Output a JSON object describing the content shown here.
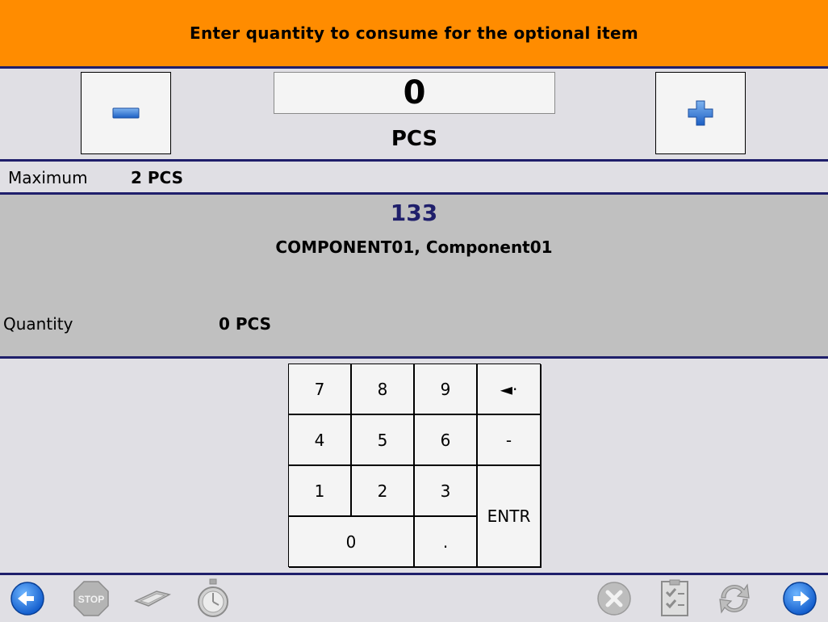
{
  "header": {
    "title": "Enter quantity to consume for the optional item"
  },
  "stepper": {
    "value": "0",
    "unit": "PCS",
    "minus_icon": "minus-icon",
    "plus_icon": "plus-icon"
  },
  "maximum": {
    "label": "Maximum",
    "value": "2 PCS"
  },
  "item": {
    "number": "133",
    "name": "COMPONENT01, Component01",
    "quantity_label": "Quantity",
    "quantity_value": "0 PCS"
  },
  "keypad": {
    "k7": "7",
    "k8": "8",
    "k9": "9",
    "backspace": "◄·",
    "k4": "4",
    "k5": "5",
    "k6": "6",
    "minus": "-",
    "k1": "1",
    "k2": "2",
    "k3": "3",
    "enter": "ENTR",
    "k0": "0",
    "dot": "."
  },
  "toolbar": {
    "left": [
      "back-icon",
      "stop-icon",
      "scanner-icon",
      "stopwatch-icon"
    ],
    "right": [
      "cancel-icon",
      "checklist-icon",
      "refresh-icon",
      "forward-icon"
    ],
    "stop_text": "STOP"
  },
  "colors": {
    "header": "#ff8c00",
    "divider": "#1f1f6b",
    "panel": "#c0c0c0",
    "background": "#e0dfe4",
    "accent_blue": "#1f6fd8"
  }
}
